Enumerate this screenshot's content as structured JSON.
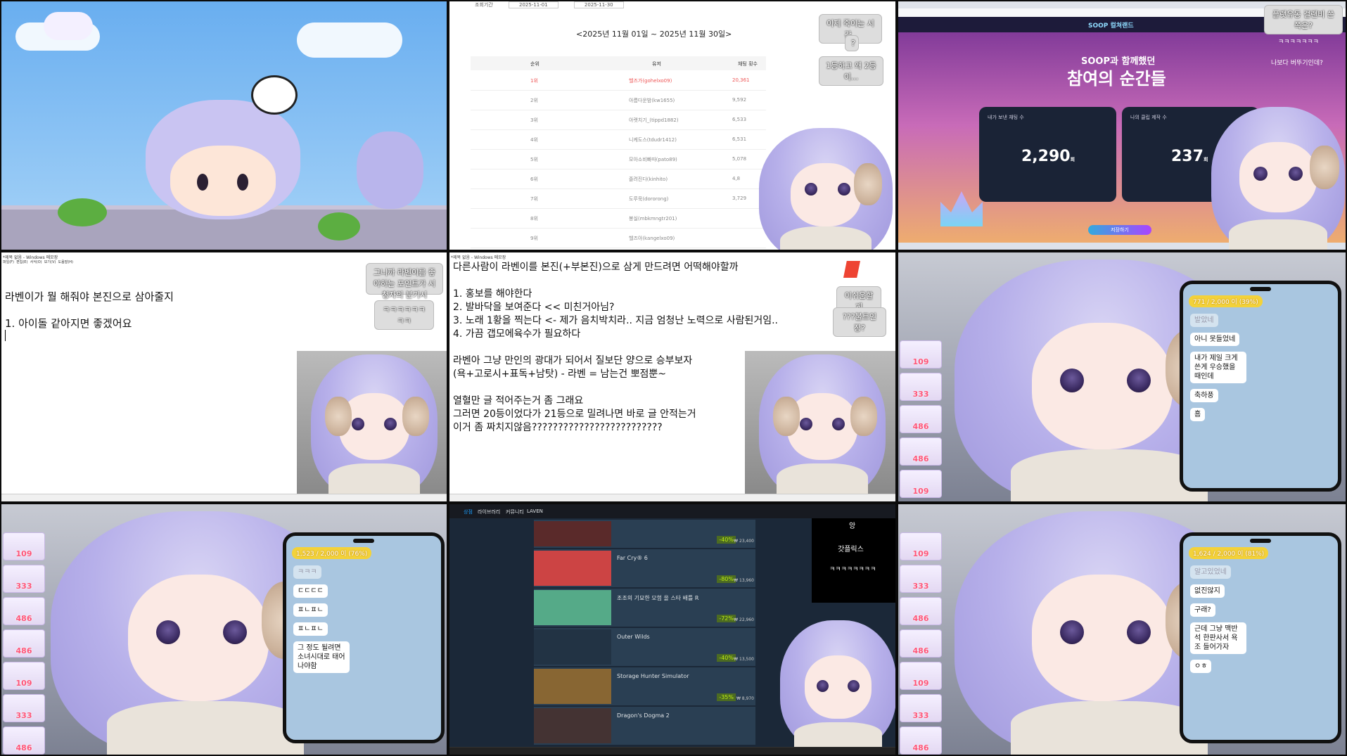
{
  "p2": {
    "title": "<2025년 11월 01일 ~ 2025년 11월 30일>",
    "filter_label": "조회기간",
    "date_from": "2025-11-01",
    "date_to": "2025-11-30",
    "headers": [
      "순위",
      "유저",
      "채팅 횟수"
    ],
    "rows": [
      {
        "rank": "1위",
        "user": "헬즈가(gohelxo09)",
        "count": "20,361"
      },
      {
        "rank": "2위",
        "user": "아름다운밤(kw1655)",
        "count": "9,592"
      },
      {
        "rank": "3위",
        "user": "아랫치기_(tippd1882)",
        "count": "6,533"
      },
      {
        "rank": "4위",
        "user": "니케도스(tdudr1412)",
        "count": "6,531"
      },
      {
        "rank": "5위",
        "user": "모아소비빠따(pato89)",
        "count": "5,078"
      },
      {
        "rank": "6위",
        "user": "졸려진다(kinhito)",
        "count": "4,8"
      },
      {
        "rank": "7위",
        "user": "도루묵(dororong)",
        "count": "3,729"
      },
      {
        "rank": "8위",
        "user": "봉실(mbkmngtr201)",
        "count": ""
      },
      {
        "rank": "9위",
        "user": "헬즈아(kangelxo09)",
        "count": ""
      }
    ],
    "bubbles": [
      "이제 죽이는 시간..",
      "?",
      "1등하고 왜 2등이..."
    ]
  },
  "p3": {
    "brand": "SOOP 컬쳐랜드",
    "subtitle": "SOOP과 함께했던",
    "headline": "참여의 순간들",
    "stat1_label": "내가 보낸 채팅 수",
    "stat1_value": "2,290",
    "stat1_unit": "회",
    "stat2_label": "나의 클립 제작 수",
    "stat2_value": "237",
    "stat2_unit": "회",
    "cta": "저장하기",
    "bubbles": [
      "플랫유동 걸랜비 쓴 쪽은?",
      "ㅋㅋㅋㅋㅋㅋㅋ",
      "나보다 버뚜기인데?"
    ]
  },
  "p4": {
    "titlebar": "*제목 없음 - Windows 메모장",
    "menu": "파일(F)  편집(E)  서식(O)  보기(V)  도움말(H)",
    "line1": "라벤이가 뭘 해줘야 본진으로 삼아줄지",
    "line2": "1. 아이돌 같아지면 좋겠어요",
    "bubbles": [
      "그니까 라벤이를 좋아하는 포인트가 시청자의 분기시",
      "ㅋㅋㅋㅋㅋㅋㅋㅋ"
    ]
  },
  "p5": {
    "titlebar": "*제목 없음 - Windows 메모장",
    "lines": [
      "다른사람이 라벤이를 본진(+부본진)으로 삼게 만드려면 어떡해야할까",
      "",
      "1. 홍보를 해야한다",
      "2. 발바닥을 보여준다 << 미친거아님?",
      "3. 노래 1황을 찍는다 <- 제가 음치박치라.. 지금 엄청난 노력으로 사람된거임..",
      "4. 가끔 갭모에육수가 필요하다",
      "",
      "라벤아 그냥 만인의 광대가 되어서 질보단 양으로 승부보자",
      "(욕+고로시+표독+남탓) - 라벤 = 남는건 뽀점뿐~",
      "",
      "열혈만 글 적어주는거 좀 그래요",
      "그러면 20등이었다가 21등으로 밀려나면 바로 글 안적는거",
      "이거 좀 짜치지않음?????????????????????????"
    ],
    "bubbles": [
      "이쉬움할게",
      "???불트인장?"
    ]
  },
  "p6": {
    "header": "771 / 2,000 이 (39%)",
    "messages": [
      "발았네",
      "아니 못들었네",
      "내가 제일 크게 쓴게 우승했을 때인데",
      "축하풍",
      "흠"
    ],
    "faded_index": 0,
    "progress": 0.39
  },
  "p7": {
    "header": "1,523 / 2,000 이 (76%)",
    "messages": [
      "ㅋㅋㅋ",
      "ㄷㄷㄷㄷ",
      "ㅍㄴㅍㄴ",
      "ㅍㄴㅍㄴ",
      "그 정도 될려면 소녀시대로 태어나야함"
    ],
    "faded_index": 0,
    "progress": 0.76
  },
  "p8": {
    "nav": [
      "상점",
      "라이브러리",
      "커뮤니티",
      "LAVEN"
    ],
    "games": [
      {
        "name": "Far Cry® 6",
        "discount": "-80%",
        "price": "₩ 13,960",
        "thumb": "#c44"
      },
      {
        "name": "조조의 기묘한 모험 올 스타 배틀 R",
        "discount": "-72%",
        "price": "₩ 22,960",
        "thumb": "#5a8"
      },
      {
        "name": "Outer Wilds",
        "discount": "-40%",
        "price": "₩ 13,500",
        "thumb": "#234"
      },
      {
        "name": "Storage Hunter Simulator",
        "discount": "-35%",
        "price": "₩ 8,970",
        "thumb": "#863"
      },
      {
        "name": "Dragon's Dogma 2",
        "discount": "",
        "price": "",
        "thumb": "#433"
      }
    ],
    "top_item_discount": "-40%",
    "top_item_price": "₩ 23,400",
    "bubbles": [
      "앙",
      "갓플릭스",
      "ㅋㅋㅋㅋㅋㅋㅋㅋ"
    ]
  },
  "p9": {
    "header": "1,624 / 2,000 이 (81%)",
    "messages": [
      "알고있었네",
      "없진않지",
      "구래?",
      "근데 그냥 맥반석 한판사서 욕조 들어가자",
      "ㅇㅎ"
    ],
    "faded_index": 0,
    "progress": 0.81
  },
  "donations": [
    "109",
    "333",
    "486",
    "486"
  ],
  "colors": {
    "accent": "#f3d23a",
    "phone": "#a9c6e0",
    "hair": "#b7b0ea",
    "steam": "#1b2838"
  }
}
